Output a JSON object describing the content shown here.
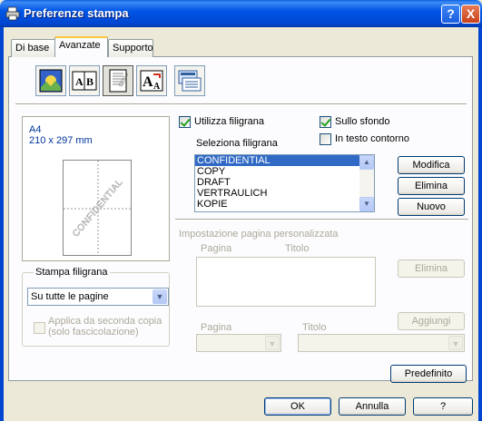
{
  "window": {
    "title": "Preferenze stampa",
    "help_btn": "?",
    "close_btn": "X"
  },
  "tabs": [
    {
      "label": "Di base"
    },
    {
      "label": "Avanzate"
    },
    {
      "label": "Supporto"
    }
  ],
  "toolbar": {
    "icons": [
      "quality-icon",
      "duplex-icon",
      "watermark-icon",
      "scaling-icon",
      "device-options-icon"
    ]
  },
  "preview": {
    "paper_size": "A4",
    "dimensions": "210 x 297 mm",
    "watermark_text": "CONFIDENTIAL"
  },
  "watermark_group": {
    "legend": "Stampa filigrana",
    "mode_value": "Su tutte le pagine",
    "from_second_copy_label": "Applica da seconda copia",
    "from_second_copy_sub": "(solo fascicolazione)"
  },
  "options": {
    "use_watermark": "Utilizza filigrana",
    "background": "Sullo sfondo",
    "outline_text": "In testo contorno",
    "select_watermark": "Seleziona filigrana"
  },
  "watermark_list": [
    "CONFIDENTIAL",
    "COPY",
    "DRAFT",
    "VERTRAULICH",
    "KOPIE"
  ],
  "list_buttons": {
    "edit": "Modifica",
    "delete": "Elimina",
    "new": "Nuovo"
  },
  "custom_page": {
    "title": "Impostazione pagina personalizzata",
    "col_page": "Pagina",
    "col_title": "Titolo",
    "delete": "Elimina",
    "add": "Aggiungi",
    "page_label": "Pagina",
    "title_label": "Titolo"
  },
  "footer": {
    "default": "Predefinito",
    "ok": "OK",
    "cancel": "Annulla",
    "help": "?"
  }
}
